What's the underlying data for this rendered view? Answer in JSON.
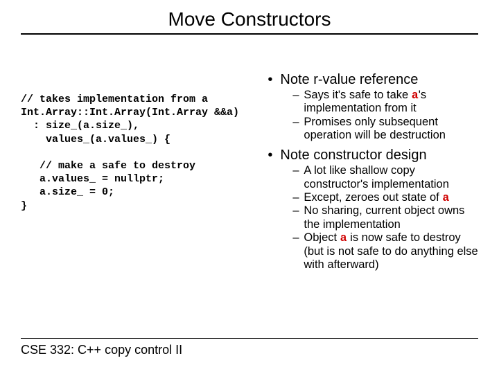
{
  "title": "Move Constructors",
  "footer": "CSE 332: C++ copy control II",
  "code": {
    "l1": "// takes implementation from a",
    "l2": "Int.Array::Int.Array(Int.Array &&a)",
    "l3": "  : size_(a.size_),",
    "l4": "    values_(a.values_) {",
    "l5": "",
    "l6": "   // make a safe to destroy",
    "l7": "   a.values_ = nullptr;",
    "l8": "   a.size_ = 0;",
    "l9": "}"
  },
  "bullets": {
    "b1": "Note r-value reference",
    "b1s1a": "Says it's safe to take ",
    "b1s1b": "'s implementation from it",
    "b1s2": "Promises only subsequent operation will be destruction",
    "b2": "Note constructor design",
    "b2s1": "A lot like shallow copy constructor's implementation",
    "b2s2a": "Except, zeroes out state of ",
    "b2s3": "No sharing, current object owns the implementation",
    "b2s4a": "Object ",
    "b2s4b": " is now safe to destroy (but is not safe to do anything else with afterward)"
  },
  "kw_a": "a"
}
